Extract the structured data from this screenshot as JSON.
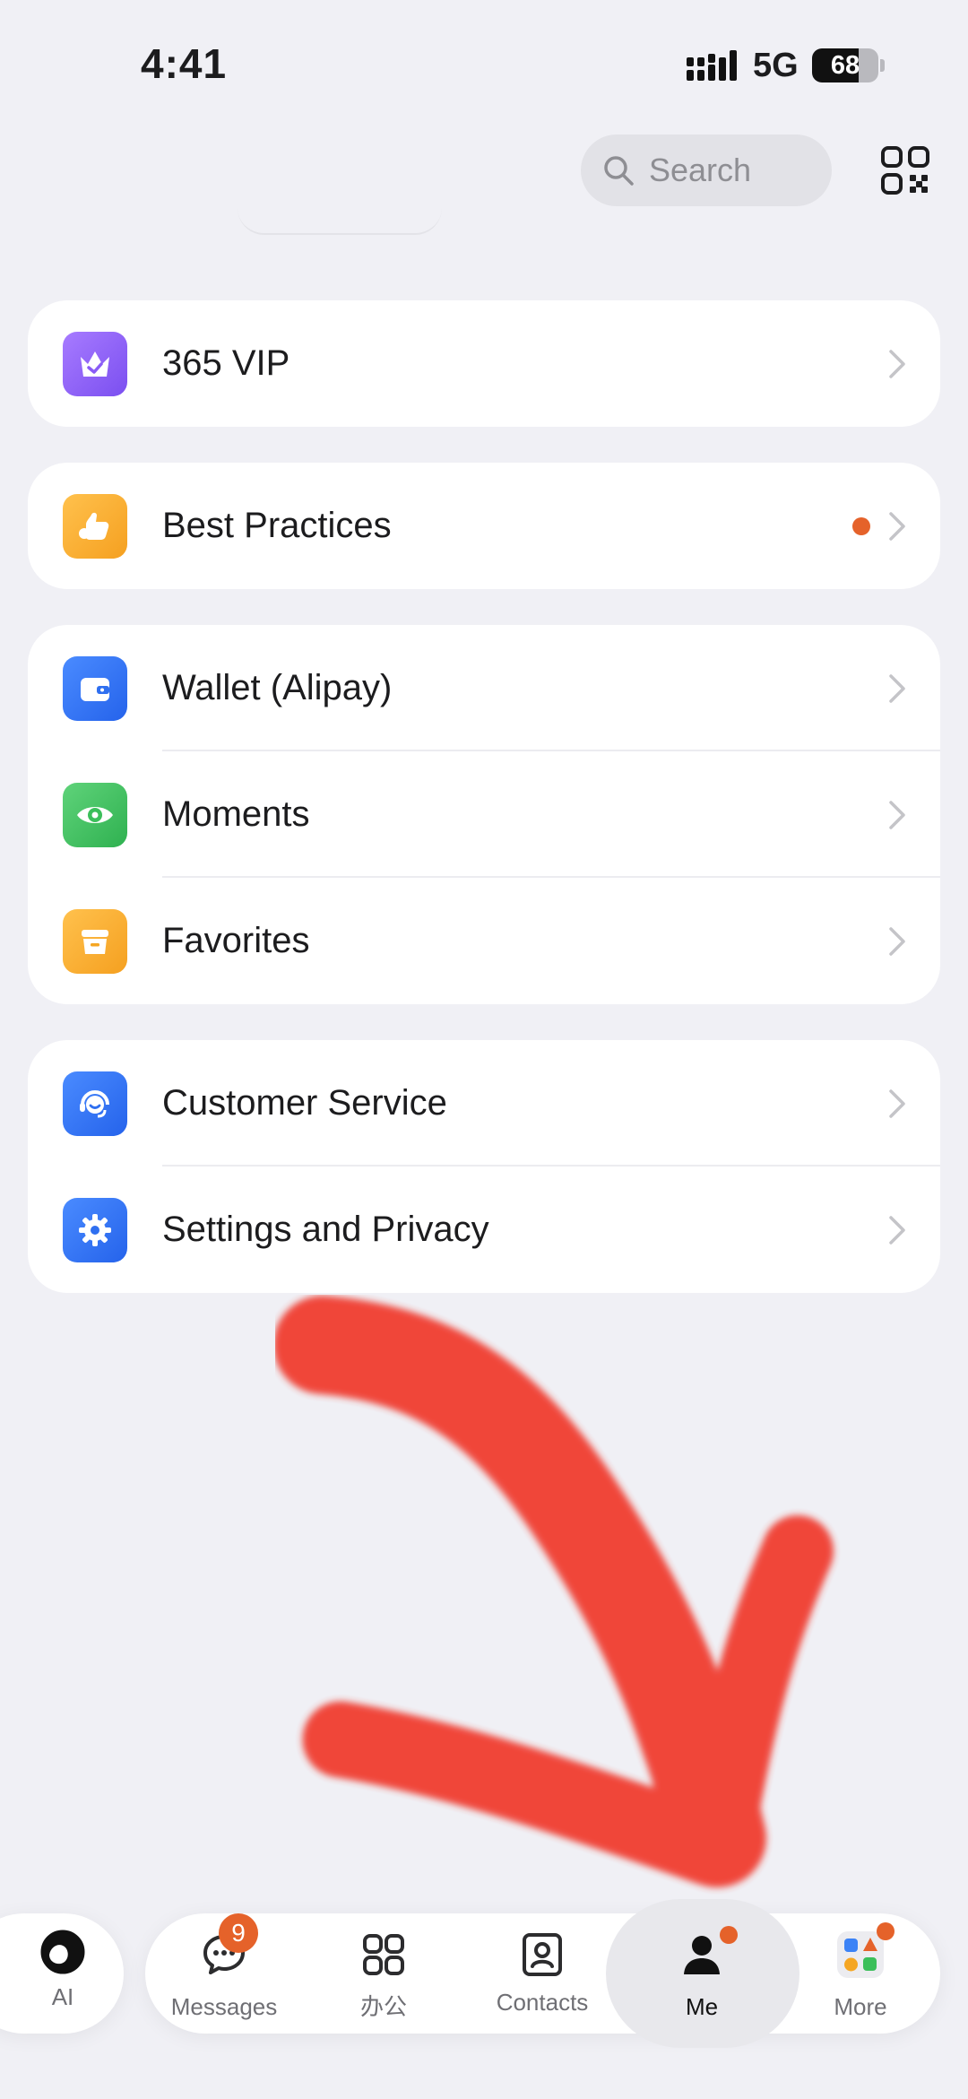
{
  "status_bar": {
    "time": "4:41",
    "network": "5G",
    "battery": "68"
  },
  "header": {
    "search_placeholder": "Search"
  },
  "menu_groups": [
    {
      "items": [
        {
          "label": "365 VIP",
          "icon": "crown-icon",
          "color": "#8a5cf6",
          "has_dot": false
        }
      ]
    },
    {
      "items": [
        {
          "label": "Best Practices",
          "icon": "thumbs-up-icon",
          "color": "#f5a623",
          "has_dot": true
        }
      ]
    },
    {
      "items": [
        {
          "label": "Wallet (Alipay)",
          "icon": "wallet-icon",
          "color": "#2f6ff0"
        },
        {
          "label": "Moments",
          "icon": "eye-icon",
          "color": "#3bbf5a"
        },
        {
          "label": "Favorites",
          "icon": "box-icon",
          "color": "#f5a623"
        }
      ]
    },
    {
      "items": [
        {
          "label": "Customer Service",
          "icon": "headset-icon",
          "color": "#2f6ff0"
        },
        {
          "label": "Settings and Privacy",
          "icon": "gear-icon",
          "color": "#2f6ff0"
        }
      ]
    }
  ],
  "tabbar": {
    "ai": {
      "label": "AI"
    },
    "tabs": [
      {
        "label": "Messages",
        "badge": "9"
      },
      {
        "label": "办公"
      },
      {
        "label": "Contacts"
      },
      {
        "label": "Me",
        "active": true
      },
      {
        "label": "More"
      }
    ]
  },
  "colors": {
    "accent_badge": "#e5622a",
    "background": "#f0f0f5",
    "annotation_arrow": "#f0382b"
  }
}
